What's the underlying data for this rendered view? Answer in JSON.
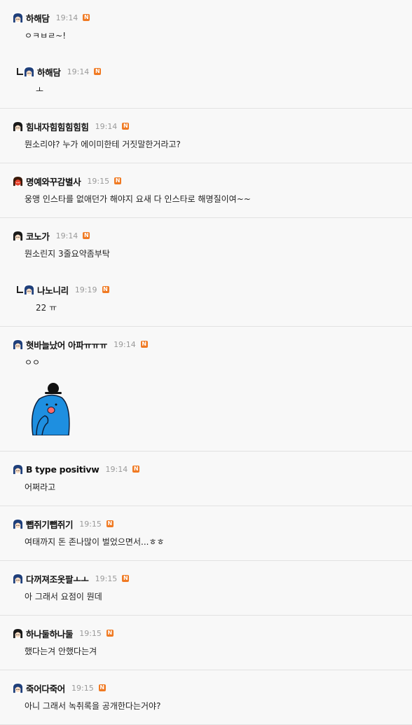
{
  "comments": [
    {
      "nick": "하해담",
      "time": "19:14",
      "badge": "N",
      "text": "ㅇㅋㅂㄹ~!",
      "reply": false,
      "avatar": "blue-hair",
      "line": false
    },
    {
      "nick": "하해담",
      "time": "19:14",
      "badge": "N",
      "text": "ㅗ",
      "reply": true,
      "avatar": "blue-hair",
      "line": true
    },
    {
      "nick": "힘내자힘힘힘힘힘",
      "time": "19:14",
      "badge": "N",
      "text": "뭔소리야? 누가 에이미한테 거짓말한거라고?",
      "reply": false,
      "avatar": "dark-hair",
      "line": true
    },
    {
      "nick": "명예와꾸감별사",
      "time": "19:15",
      "badge": "N",
      "text": "웅앵 인스타를 없애던가 해야지 요새 다 인스타로 해명질이여~~",
      "reply": false,
      "avatar": "red-face",
      "line": true
    },
    {
      "nick": "코노가",
      "time": "19:14",
      "badge": "N",
      "text": "뭔소린지 3줄요약좀부탁",
      "reply": false,
      "avatar": "dark-hair",
      "line": false
    },
    {
      "nick": "나노니리",
      "time": "19:19",
      "badge": "N",
      "text": "22 ㅠ",
      "reply": true,
      "avatar": "blue-hair",
      "line": true
    },
    {
      "nick": "혓바늘났어 아파ㅠㅠㅠ",
      "time": "19:14",
      "badge": "N",
      "text": "ㅇㅇ",
      "reply": false,
      "avatar": "blue-hair",
      "line": true,
      "sticker": "blue-character-bowler-hat"
    },
    {
      "nick": "B type positivw",
      "time": "19:14",
      "badge": "N",
      "text": "어쩌라고",
      "reply": false,
      "avatar": "blue-hair",
      "line": true
    },
    {
      "nick": "뺍쥐기뺍쥐기",
      "time": "19:15",
      "badge": "N",
      "text": "여태까지 돈 존나많이 벌었으면서...ㅎㅎ",
      "reply": false,
      "avatar": "blue-hair",
      "line": true
    },
    {
      "nick": "다꺼져조옷팔ㅗㅗ",
      "time": "19:15",
      "badge": "N",
      "text": "아 그래서 요점이 뭔데",
      "reply": false,
      "avatar": "blue-hair",
      "line": true
    },
    {
      "nick": "하나둘하나둘",
      "time": "19:15",
      "badge": "N",
      "text": "했다는겨 안했다는겨",
      "reply": false,
      "avatar": "dark-hair",
      "line": true
    },
    {
      "nick": "죽어다죽어",
      "time": "19:15",
      "badge": "N",
      "text": "아니 그래서 녹취록을 공개한다는거야?",
      "reply": false,
      "avatar": "blue-hair",
      "line": true
    }
  ]
}
